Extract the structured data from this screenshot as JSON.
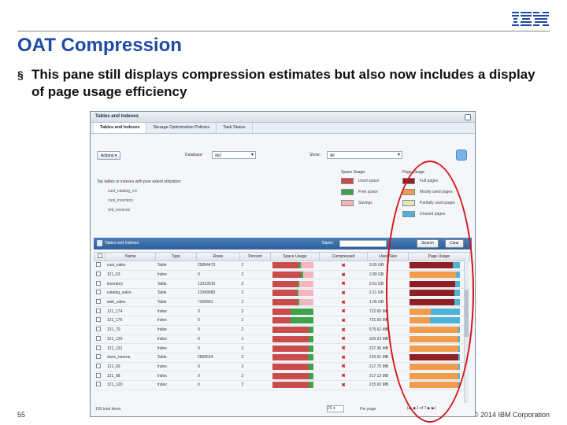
{
  "slide": {
    "brand": "IBM",
    "title": "OAT Compression",
    "bullet": "This pane still displays compression estimates but also now includes a display of page usage efficiency",
    "slide_number": "55",
    "copyright": "© 2014 IBM Corporation"
  },
  "app": {
    "panel_title": "Tables and Indexes",
    "tabs": [
      "Tables and Indexes",
      "Storage Optimization Policies",
      "Task Status"
    ],
    "actions_label": "Actions",
    "database_label": "Database:",
    "database_value": "ds2",
    "show_label": "Show:",
    "show_value": "All",
    "top_tables_header": "Top tables or indexes with poor extent utilization:",
    "top_tables": [
      "cust_catalog_ix1",
      "cust_inventory",
      "ord_invoices"
    ],
    "space_usage_header": "Space Usage:",
    "space_usage_items": [
      "Used space",
      "Free space",
      "Savings"
    ],
    "space_usage_colors": [
      "#c94b4b",
      "#3fa34a",
      "#f3b6bf"
    ],
    "page_usage_header": "Page Usage:",
    "page_usage_items": [
      "Full pages",
      "Mostly used pages",
      "Partially used pages",
      "Unused pages"
    ],
    "page_usage_colors": [
      "#8f1f24",
      "#f29d4c",
      "#dfe8b8",
      "#4fb3d9"
    ],
    "grid_title": "Tables and Indexes",
    "name_filter_label": "Name:",
    "search_label": "Search",
    "clear_label": "Clear",
    "columns": [
      "Name",
      "Type",
      "Rows",
      "Percent",
      "Space Usage",
      "Compressed",
      "Used Size",
      "Page Usage"
    ],
    "rows": [
      {
        "name": "cust_sales",
        "type": "Table",
        "rows": "25894473",
        "percent": "2",
        "used": 0.65,
        "free": 0.05,
        "save": 0.3,
        "size": "3.65 GB",
        "pfull": 0.86,
        "pmost": 0.0,
        "ppart": 0.0,
        "punused": 0.14
      },
      {
        "name": "121_63",
        "type": "Index",
        "rows": "0",
        "percent": "2",
        "used": 0.7,
        "free": 0.05,
        "save": 0.25,
        "size": "2.80 GB",
        "pfull": 0.0,
        "pmost": 0.92,
        "ppart": 0.0,
        "punused": 0.08
      },
      {
        "name": "inventory",
        "type": "Table",
        "rows": "13313010",
        "percent": "2",
        "used": 0.62,
        "free": 0.05,
        "save": 0.33,
        "size": "2.51 GB",
        "pfull": 0.9,
        "pmost": 0.0,
        "ppart": 0.0,
        "punused": 0.1
      },
      {
        "name": "catalog_sales",
        "type": "Table",
        "rows": "13368583",
        "percent": "2",
        "used": 0.6,
        "free": 0.05,
        "save": 0.35,
        "size": "2.11 GB",
        "pfull": 0.88,
        "pmost": 0.0,
        "ppart": 0.0,
        "punused": 0.12
      },
      {
        "name": "web_sales",
        "type": "Table",
        "rows": "7200601",
        "percent": "2",
        "used": 0.62,
        "free": 0.05,
        "save": 0.33,
        "size": "1.05 GB",
        "pfull": 0.88,
        "pmost": 0.0,
        "ppart": 0.0,
        "punused": 0.12
      },
      {
        "name": "121_174",
        "type": "Index",
        "rows": "0",
        "percent": "2",
        "used": 0.45,
        "free": 0.55,
        "save": 0.0,
        "size": "722.65 MB",
        "pfull": 0.0,
        "pmost": 0.42,
        "ppart": 0.0,
        "punused": 0.58
      },
      {
        "name": "121_175",
        "type": "Index",
        "rows": "0",
        "percent": "2",
        "used": 0.45,
        "free": 0.55,
        "save": 0.0,
        "size": "721.59 MB",
        "pfull": 0.0,
        "pmost": 0.4,
        "ppart": 0.0,
        "punused": 0.6
      },
      {
        "name": "121_70",
        "type": "Index",
        "rows": "0",
        "percent": "2",
        "used": 0.9,
        "free": 0.1,
        "save": 0.0,
        "size": "575.62 MB",
        "pfull": 0.0,
        "pmost": 0.96,
        "ppart": 0.0,
        "punused": 0.04
      },
      {
        "name": "121_130",
        "type": "Index",
        "rows": "0",
        "percent": "2",
        "used": 0.9,
        "free": 0.1,
        "save": 0.0,
        "size": "320.23 MB",
        "pfull": 0.0,
        "pmost": 0.96,
        "ppart": 0.0,
        "punused": 0.04
      },
      {
        "name": "121_131",
        "type": "Index",
        "rows": "0",
        "percent": "2",
        "used": 0.9,
        "free": 0.1,
        "save": 0.0,
        "size": "227.36 MB",
        "pfull": 0.0,
        "pmost": 0.96,
        "ppart": 0.0,
        "punused": 0.04
      },
      {
        "name": "store_returns",
        "type": "Table",
        "rows": "2800524",
        "percent": "2",
        "used": 0.88,
        "free": 0.12,
        "save": 0.0,
        "size": "220.01 MB",
        "pfull": 0.96,
        "pmost": 0.0,
        "ppart": 0.0,
        "punused": 0.04
      },
      {
        "name": "121_69",
        "type": "Index",
        "rows": "0",
        "percent": "2",
        "used": 0.9,
        "free": 0.1,
        "save": 0.0,
        "size": "217.75 MB",
        "pfull": 0.0,
        "pmost": 0.96,
        "ppart": 0.0,
        "punused": 0.04
      },
      {
        "name": "121_68",
        "type": "Index",
        "rows": "0",
        "percent": "2",
        "used": 0.9,
        "free": 0.1,
        "save": 0.0,
        "size": "217.13 MB",
        "pfull": 0.0,
        "pmost": 0.96,
        "ppart": 0.0,
        "punused": 0.04
      },
      {
        "name": "121_120",
        "type": "Index",
        "rows": "0",
        "percent": "2",
        "used": 0.9,
        "free": 0.1,
        "save": 0.0,
        "size": "215.63 MB",
        "pfull": 0.0,
        "pmost": 0.96,
        "ppart": 0.0,
        "punused": 0.04
      }
    ],
    "footer_total": "156 total items",
    "per_page_value": "25",
    "per_page_label": "Per page",
    "page_current": "1",
    "page_total": "of 7"
  }
}
